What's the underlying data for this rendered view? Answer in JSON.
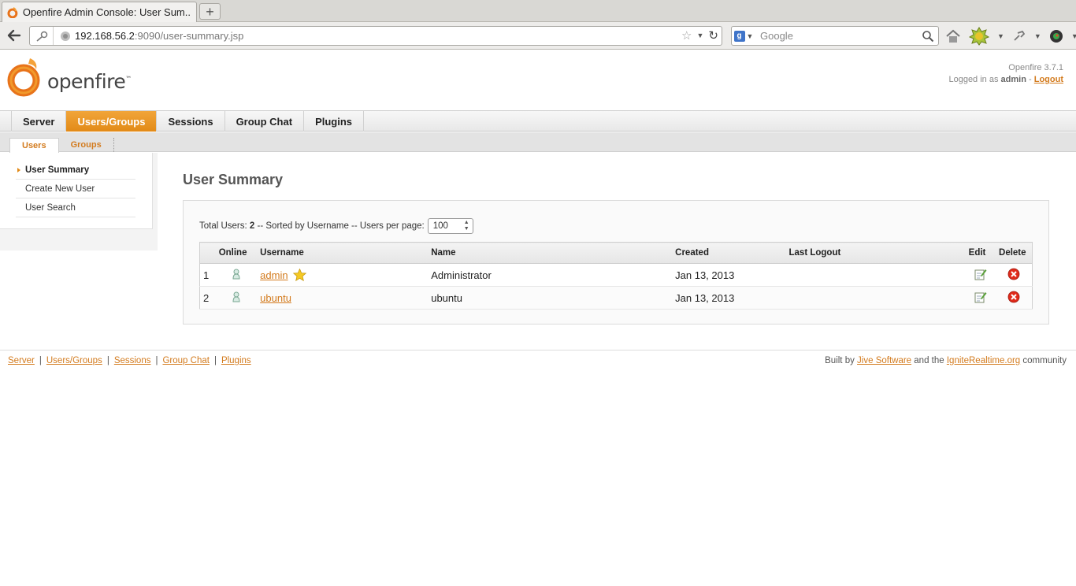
{
  "browser": {
    "tab_title": "Openfire Admin Console: User Sum...",
    "new_tab_symbol": "+",
    "url_host": "192.168.56.2",
    "url_rest": ":9090/user-summary.jsp",
    "search_placeholder": "Google"
  },
  "header": {
    "logo_text": "openfire",
    "logo_tm": "™",
    "version": "Openfire 3.7.1",
    "logged_in_prefix": "Logged in as",
    "username": "admin",
    "dash": "-",
    "logout_label": "Logout"
  },
  "main_tabs": [
    {
      "label": "Server"
    },
    {
      "label": "Users/Groups"
    },
    {
      "label": "Sessions"
    },
    {
      "label": "Group Chat"
    },
    {
      "label": "Plugins"
    }
  ],
  "sub_tabs": [
    {
      "label": "Users"
    },
    {
      "label": "Groups"
    }
  ],
  "sidebar": {
    "items": [
      {
        "label": "User Summary"
      },
      {
        "label": "Create New User"
      },
      {
        "label": "User Search"
      }
    ]
  },
  "content": {
    "title": "User Summary",
    "total_label": "Total Users:",
    "total_count": "2",
    "sort_text": "-- Sorted by Username -- Users per page:",
    "per_page": "100",
    "columns": {
      "online": "Online",
      "username": "Username",
      "name": "Name",
      "created": "Created",
      "last_logout": "Last Logout",
      "edit": "Edit",
      "delete": "Delete"
    },
    "rows": [
      {
        "num": "1",
        "username": "admin",
        "name": "Administrator",
        "created": "Jan 13, 2013",
        "last_logout": ""
      },
      {
        "num": "2",
        "username": "ubuntu",
        "name": "ubuntu",
        "created": "Jan 13, 2013",
        "last_logout": ""
      }
    ]
  },
  "footer": {
    "links": [
      "Server",
      "Users/Groups",
      "Sessions",
      "Group Chat",
      "Plugins"
    ],
    "separator": "|",
    "built_by_prefix": "Built by",
    "jive_link": "Jive Software",
    "and_the": "and the",
    "ignite_link": "IgniteRealtime.org",
    "community": "community"
  },
  "colors": {
    "accent": "#e28a17",
    "link": "#d37b1e"
  }
}
